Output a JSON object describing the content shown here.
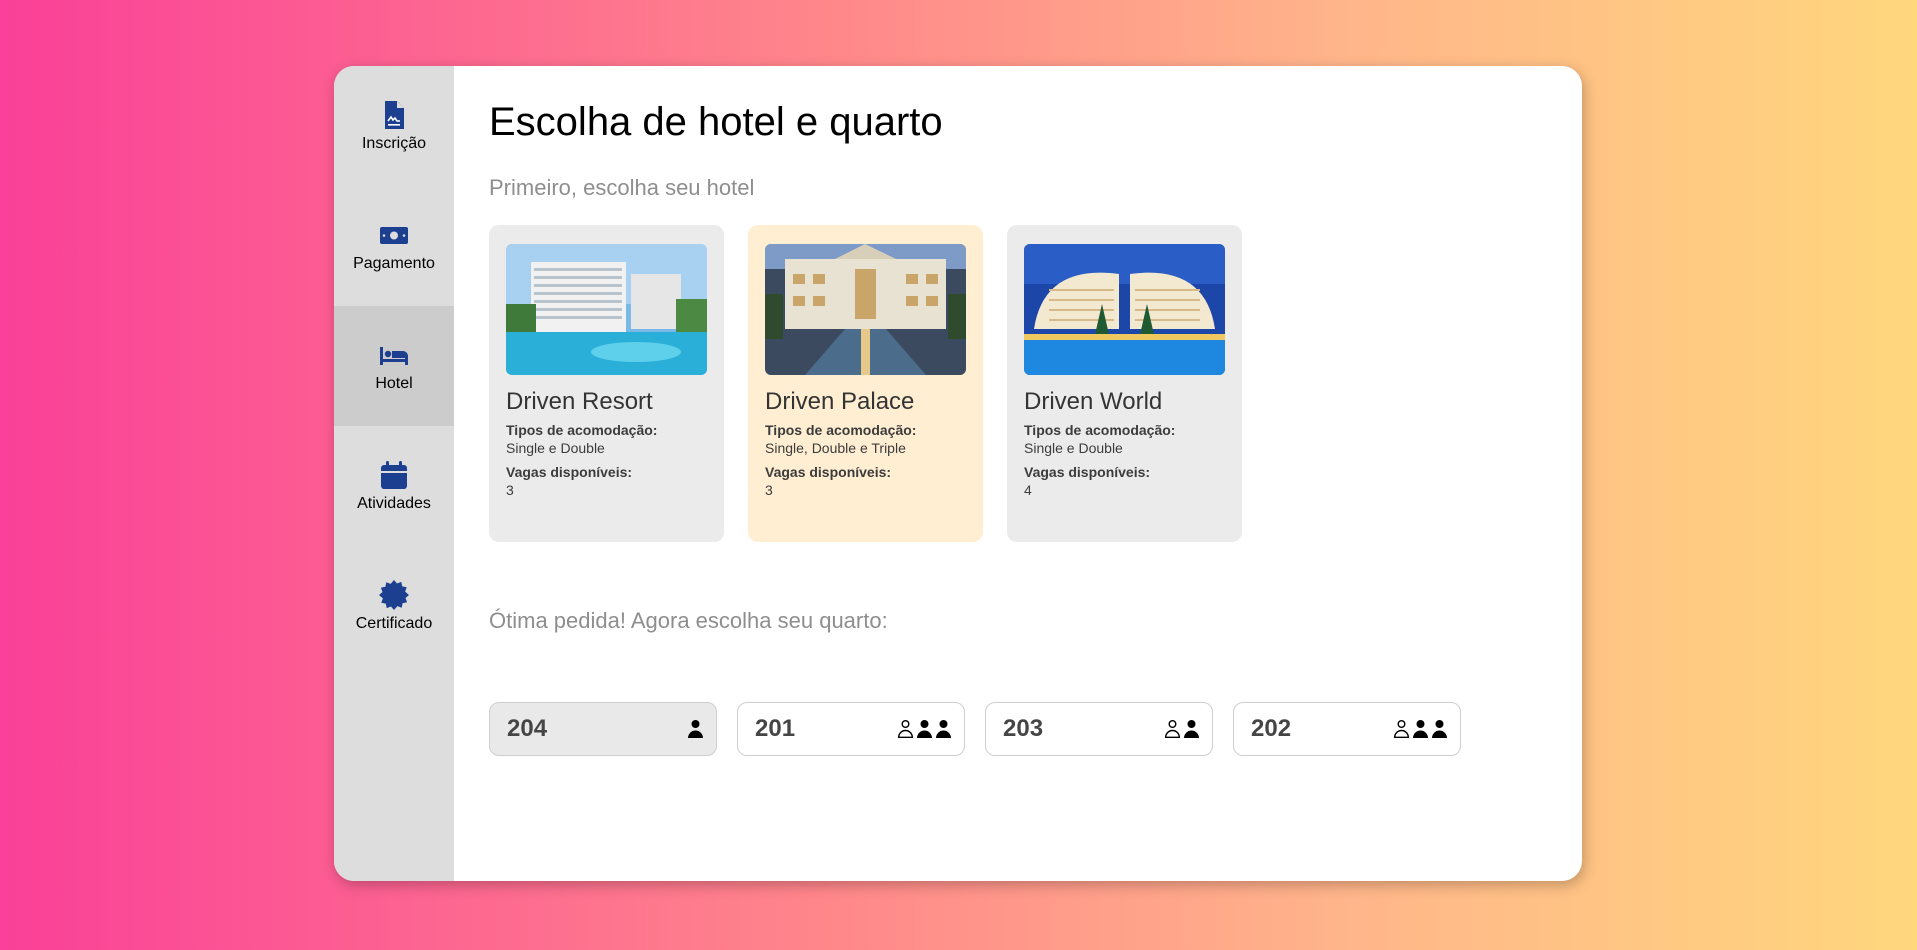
{
  "sidebar": {
    "items": [
      {
        "label": "Inscrição",
        "icon": "document-icon"
      },
      {
        "label": "Pagamento",
        "icon": "money-icon"
      },
      {
        "label": "Hotel",
        "icon": "bed-icon",
        "active": true
      },
      {
        "label": "Atividades",
        "icon": "calendar-icon"
      },
      {
        "label": "Certificado",
        "icon": "certificate-icon"
      }
    ],
    "icon_color": "#1c3f8f"
  },
  "main": {
    "title": "Escolha de hotel e quarto",
    "hotel_prompt": "Primeiro, escolha seu hotel",
    "room_prompt": "Ótima pedida! Agora escolha seu quarto:"
  },
  "hotels": [
    {
      "name": "Driven Resort",
      "types_label": "Tipos de acomodação:",
      "types": "Single e Double",
      "vacancies_label": "Vagas disponíveis:",
      "vacancies": "3",
      "selected": false
    },
    {
      "name": "Driven Palace",
      "types_label": "Tipos de acomodação:",
      "types": "Single, Double e Triple",
      "vacancies_label": "Vagas disponíveis:",
      "vacancies": "3",
      "selected": true
    },
    {
      "name": "Driven World",
      "types_label": "Tipos de acomodação:",
      "types": "Single e Double",
      "vacancies_label": "Vagas disponíveis:",
      "vacancies": "4",
      "selected": false
    }
  ],
  "rooms": [
    {
      "number": "204",
      "capacity": 1,
      "occupied": 1,
      "full": true
    },
    {
      "number": "201",
      "capacity": 3,
      "occupied": 2,
      "full": false
    },
    {
      "number": "203",
      "capacity": 2,
      "occupied": 1,
      "full": false
    },
    {
      "number": "202",
      "capacity": 3,
      "occupied": 2,
      "full": false
    }
  ],
  "colors": {
    "selected_card": "#ffeed2",
    "card": "#ebebeb",
    "sidebar": "#dddddd",
    "sidebar_active": "#cccccc"
  }
}
